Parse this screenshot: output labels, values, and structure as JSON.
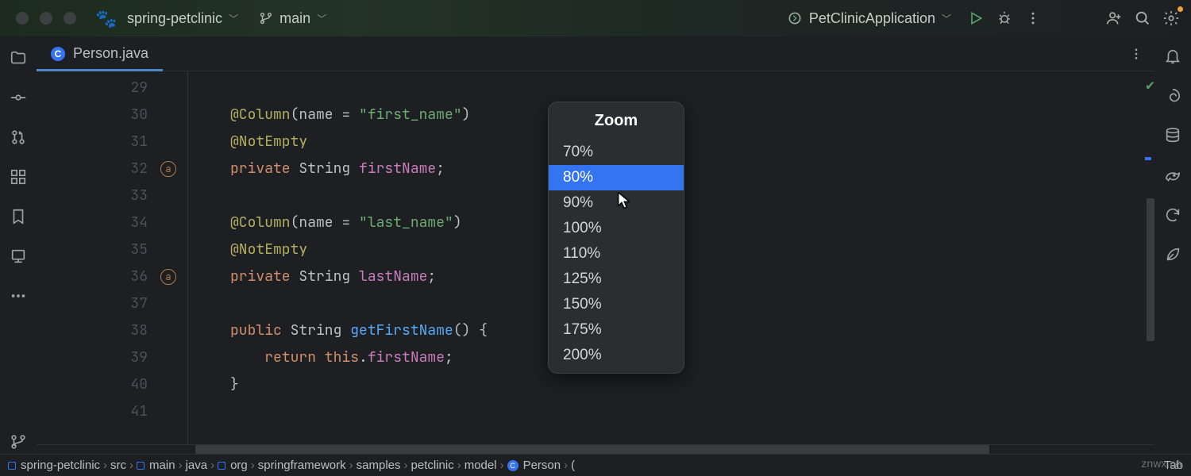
{
  "topbar": {
    "project": "spring-petclinic",
    "branch": "main",
    "run_config": "PetClinicApplication"
  },
  "tab": {
    "filename": "Person.java"
  },
  "code_lines": [
    {
      "n": 29,
      "html": ""
    },
    {
      "n": 30,
      "html": "<span class='ann'>@Column</span>(name = <span class='str'>\"first_name\"</span>)"
    },
    {
      "n": 31,
      "html": "<span class='ann'>@NotEmpty</span>"
    },
    {
      "n": 32,
      "html": "<span class='kw'>private</span> String <span class='fld'>firstName</span>;",
      "mark": "a"
    },
    {
      "n": 33,
      "html": ""
    },
    {
      "n": 34,
      "html": "<span class='ann'>@Column</span>(name = <span class='str'>\"last_name\"</span>)"
    },
    {
      "n": 35,
      "html": "<span class='ann'>@NotEmpty</span>"
    },
    {
      "n": 36,
      "html": "<span class='kw'>private</span> String <span class='fld'>lastName</span>;",
      "mark": "a"
    },
    {
      "n": 37,
      "html": ""
    },
    {
      "n": 38,
      "html": "<span class='kw'>public</span> String <span class='fn'>getFirstName</span>() {"
    },
    {
      "n": 39,
      "html": "    <span class='kw'>return this</span>.<span class='fld'>firstName</span>;"
    },
    {
      "n": 40,
      "html": "}"
    },
    {
      "n": 41,
      "html": ""
    }
  ],
  "popup": {
    "title": "Zoom",
    "items": [
      "70%",
      "80%",
      "90%",
      "100%",
      "110%",
      "125%",
      "150%",
      "175%",
      "200%"
    ],
    "selected_index": 1
  },
  "breadcrumb": [
    {
      "label": "spring-petclinic",
      "dir": true
    },
    {
      "label": "src"
    },
    {
      "label": "main",
      "dir": true
    },
    {
      "label": "java"
    },
    {
      "label": "org",
      "dir": true
    },
    {
      "label": "springframework"
    },
    {
      "label": "samples"
    },
    {
      "label": "petclinic"
    },
    {
      "label": "model"
    },
    {
      "label": "Person",
      "cls": true
    },
    {
      "label": "(",
      "plain": true
    }
  ],
  "status_right": "Tab",
  "watermark": "znwx.cn"
}
